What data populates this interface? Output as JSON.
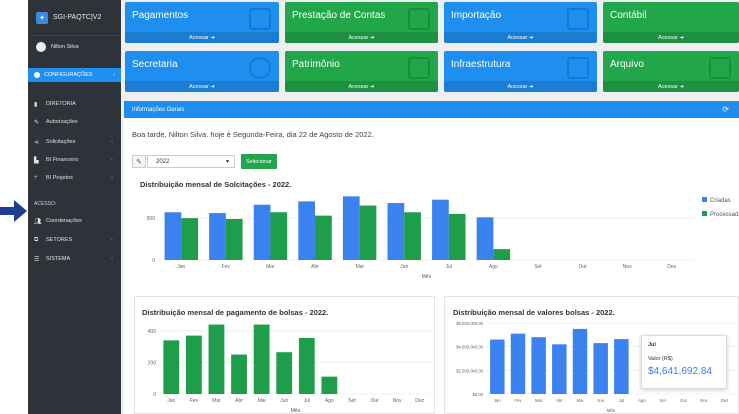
{
  "app": {
    "name": "SGI-PAQTC|V2",
    "user": "Nilton Silva"
  },
  "sidebar": {
    "config_label": "CONFIGURAÇÕES",
    "items": [
      {
        "label": "DIRETORIA",
        "icon": "building-icon"
      },
      {
        "label": "Autorizações",
        "icon": "tools-icon"
      },
      {
        "label": "Solicitações",
        "icon": "share-icon"
      },
      {
        "label": "BI Financeiro",
        "icon": "bar-chart-icon"
      },
      {
        "label": "BI Projetos",
        "icon": "branch-icon"
      }
    ],
    "access_label": "ACESSO:",
    "access_items": [
      {
        "label": "Coordenações",
        "icon": "users-icon"
      },
      {
        "label": "SETORES",
        "icon": "sitemap-icon"
      },
      {
        "label": "SISTEMA",
        "icon": "server-icon"
      }
    ]
  },
  "tiles": [
    {
      "title": "Pagamentos",
      "action": "Acessar",
      "color": "#1e8ef0"
    },
    {
      "title": "Prestação de Contas",
      "action": "Acessar",
      "color": "#22a64a"
    },
    {
      "title": "Importação",
      "action": "Acessar",
      "color": "#1e8ef0"
    },
    {
      "title": "Contábil",
      "action": "Acessar",
      "color": "#22a64a"
    },
    {
      "title": "Secretaria",
      "action": "Acessar",
      "color": "#1e8ef0"
    },
    {
      "title": "Patrimônio",
      "action": "Acessar",
      "color": "#22a64a"
    },
    {
      "title": "Infraestrutura",
      "action": "Acessar",
      "color": "#1e8ef0"
    },
    {
      "title": "Arquivo",
      "action": "Acessar",
      "color": "#22a64a"
    }
  ],
  "panel": {
    "title": "Informações Gerais",
    "greeting": "Boa tarde, Nilton Silva. hoje é Segunda-Feira, dia 22 de Agosto de 2022.",
    "year_value": "2022",
    "select_button": "Selecionar"
  },
  "chart_data": [
    {
      "type": "bar",
      "title": "Distribuição mensal de Solcitações - 2022.",
      "xlabel": "Mês",
      "categories": [
        "Jan",
        "Fev",
        "Mar",
        "Abr",
        "Mai",
        "Jun",
        "Jul",
        "Ago",
        "Set",
        "Out",
        "Nov",
        "Dez"
      ],
      "ylim": [
        0,
        800
      ],
      "yticks": [
        "500",
        "0"
      ],
      "series": [
        {
          "name": "Criadas",
          "color": "#3b82f0",
          "values": [
            570,
            560,
            660,
            700,
            760,
            680,
            720,
            510,
            null,
            null,
            null,
            null
          ]
        },
        {
          "name": "Processadas",
          "color": "#1e9e4a",
          "values": [
            500,
            490,
            570,
            530,
            650,
            570,
            550,
            130,
            null,
            null,
            null,
            null
          ]
        }
      ],
      "legend": "right"
    },
    {
      "type": "bar",
      "title": "Distribuição mensal de pagamento de bolsas - 2022.",
      "xlabel": "Mês",
      "categories": [
        "Jan",
        "Fev",
        "Mar",
        "Abr",
        "Mai",
        "Jun",
        "Jul",
        "Ago",
        "Set",
        "Out",
        "Nov",
        "Dez"
      ],
      "ylim": [
        0,
        450
      ],
      "yticks": [
        "400",
        "200",
        "0"
      ],
      "series": [
        {
          "color": "#1e9e4a",
          "values": [
            340,
            370,
            440,
            250,
            440,
            265,
            355,
            110,
            null,
            null,
            null,
            null
          ]
        }
      ]
    },
    {
      "type": "bar",
      "title": "Distribuição mensal de valores bolsas - 2022.",
      "xlabel": "Mês",
      "categories": [
        "Jan",
        "Fev",
        "Mar",
        "Abr",
        "Mai",
        "Jun",
        "Jul",
        "Ago",
        "Set",
        "Out",
        "Nov",
        "Dez"
      ],
      "ylim": [
        0,
        6000000
      ],
      "yticks": [
        "$6,000,000.00",
        "$4,000,000.00",
        "$2,000,000.00",
        "$0.00"
      ],
      "series": [
        {
          "color": "#3b82f0",
          "values": [
            4600000,
            5100000,
            4800000,
            4200000,
            5500000,
            4300000,
            4641692.84,
            null,
            null,
            null,
            null,
            null
          ]
        }
      ],
      "tooltip": {
        "month": "Jul",
        "label": "Valor (R$)",
        "value": "$4,641,692.84"
      }
    }
  ]
}
